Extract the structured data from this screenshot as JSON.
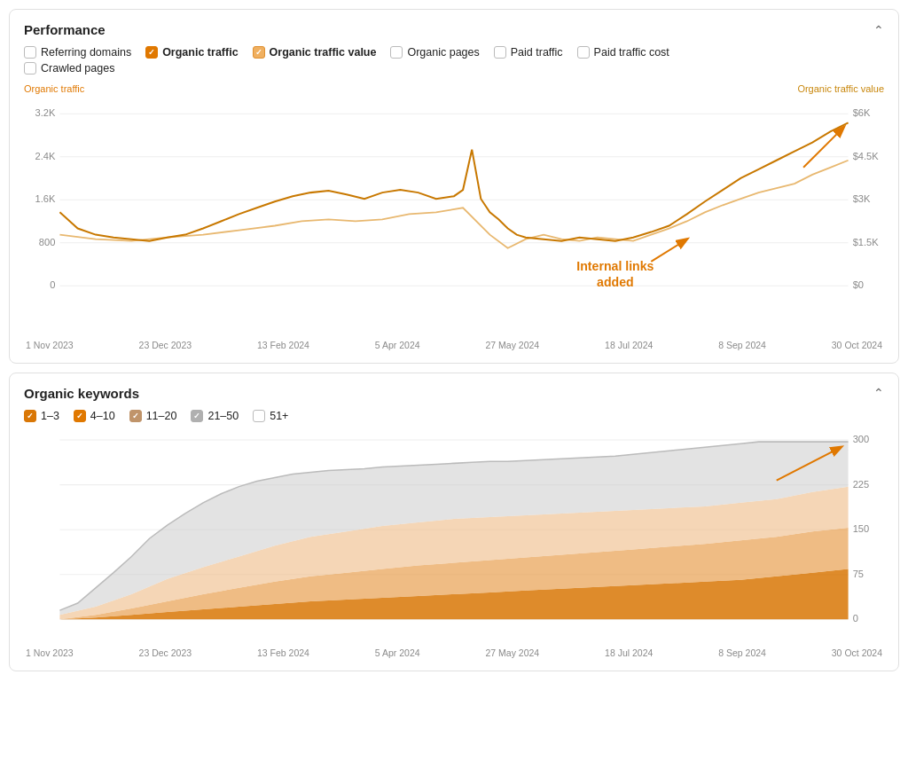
{
  "performance": {
    "title": "Performance",
    "filters": [
      {
        "id": "referring-domains",
        "label": "Referring domains",
        "checked": false,
        "checkStyle": "none"
      },
      {
        "id": "organic-traffic",
        "label": "Organic traffic",
        "checked": true,
        "checkStyle": "checked"
      },
      {
        "id": "organic-traffic-value",
        "label": "Organic traffic value",
        "checked": true,
        "checkStyle": "checked-light"
      },
      {
        "id": "organic-pages",
        "label": "Organic pages",
        "checked": false,
        "checkStyle": "none"
      },
      {
        "id": "paid-traffic",
        "label": "Paid traffic",
        "checked": false,
        "checkStyle": "none"
      },
      {
        "id": "paid-traffic-cost",
        "label": "Paid traffic cost",
        "checked": false,
        "checkStyle": "none"
      },
      {
        "id": "crawled-pages",
        "label": "Crawled pages",
        "checked": false,
        "checkStyle": "none"
      }
    ],
    "leftAxisLabel": "Organic traffic",
    "rightAxisLabel": "Organic traffic value",
    "leftAxisValues": [
      "3.2K",
      "2.4K",
      "1.6K",
      "800",
      "0"
    ],
    "rightAxisValues": [
      "$6K",
      "$4.5K",
      "$3K",
      "$1.5K",
      "$0"
    ],
    "xAxisLabels": [
      "1 Nov 2023",
      "23 Dec 2023",
      "13 Feb 2024",
      "5 Apr 2024",
      "27 May 2024",
      "18 Jul 2024",
      "8 Sep 2024",
      "30 Oct 2024"
    ],
    "annotation": "Internal links\nadded"
  },
  "keywords": {
    "title": "Organic keywords",
    "filters": [
      {
        "id": "kw-1-3",
        "label": "1–3",
        "checked": true,
        "color": "#d97706"
      },
      {
        "id": "kw-4-10",
        "label": "4–10",
        "checked": true,
        "color": "#e07800"
      },
      {
        "id": "kw-11-20",
        "label": "11–20",
        "checked": true,
        "color": "#c0946a"
      },
      {
        "id": "kw-21-50",
        "label": "21–50",
        "checked": true,
        "color": "#b0b0b0"
      },
      {
        "id": "kw-51plus",
        "label": "51+",
        "checked": false,
        "color": "#ccc"
      }
    ],
    "yAxisValues": [
      "300",
      "225",
      "150",
      "75",
      "0"
    ],
    "xAxisLabels": [
      "1 Nov 2023",
      "23 Dec 2023",
      "13 Feb 2024",
      "5 Apr 2024",
      "27 May 2024",
      "18 Jul 2024",
      "8 Sep 2024",
      "30 Oct 2024"
    ]
  }
}
